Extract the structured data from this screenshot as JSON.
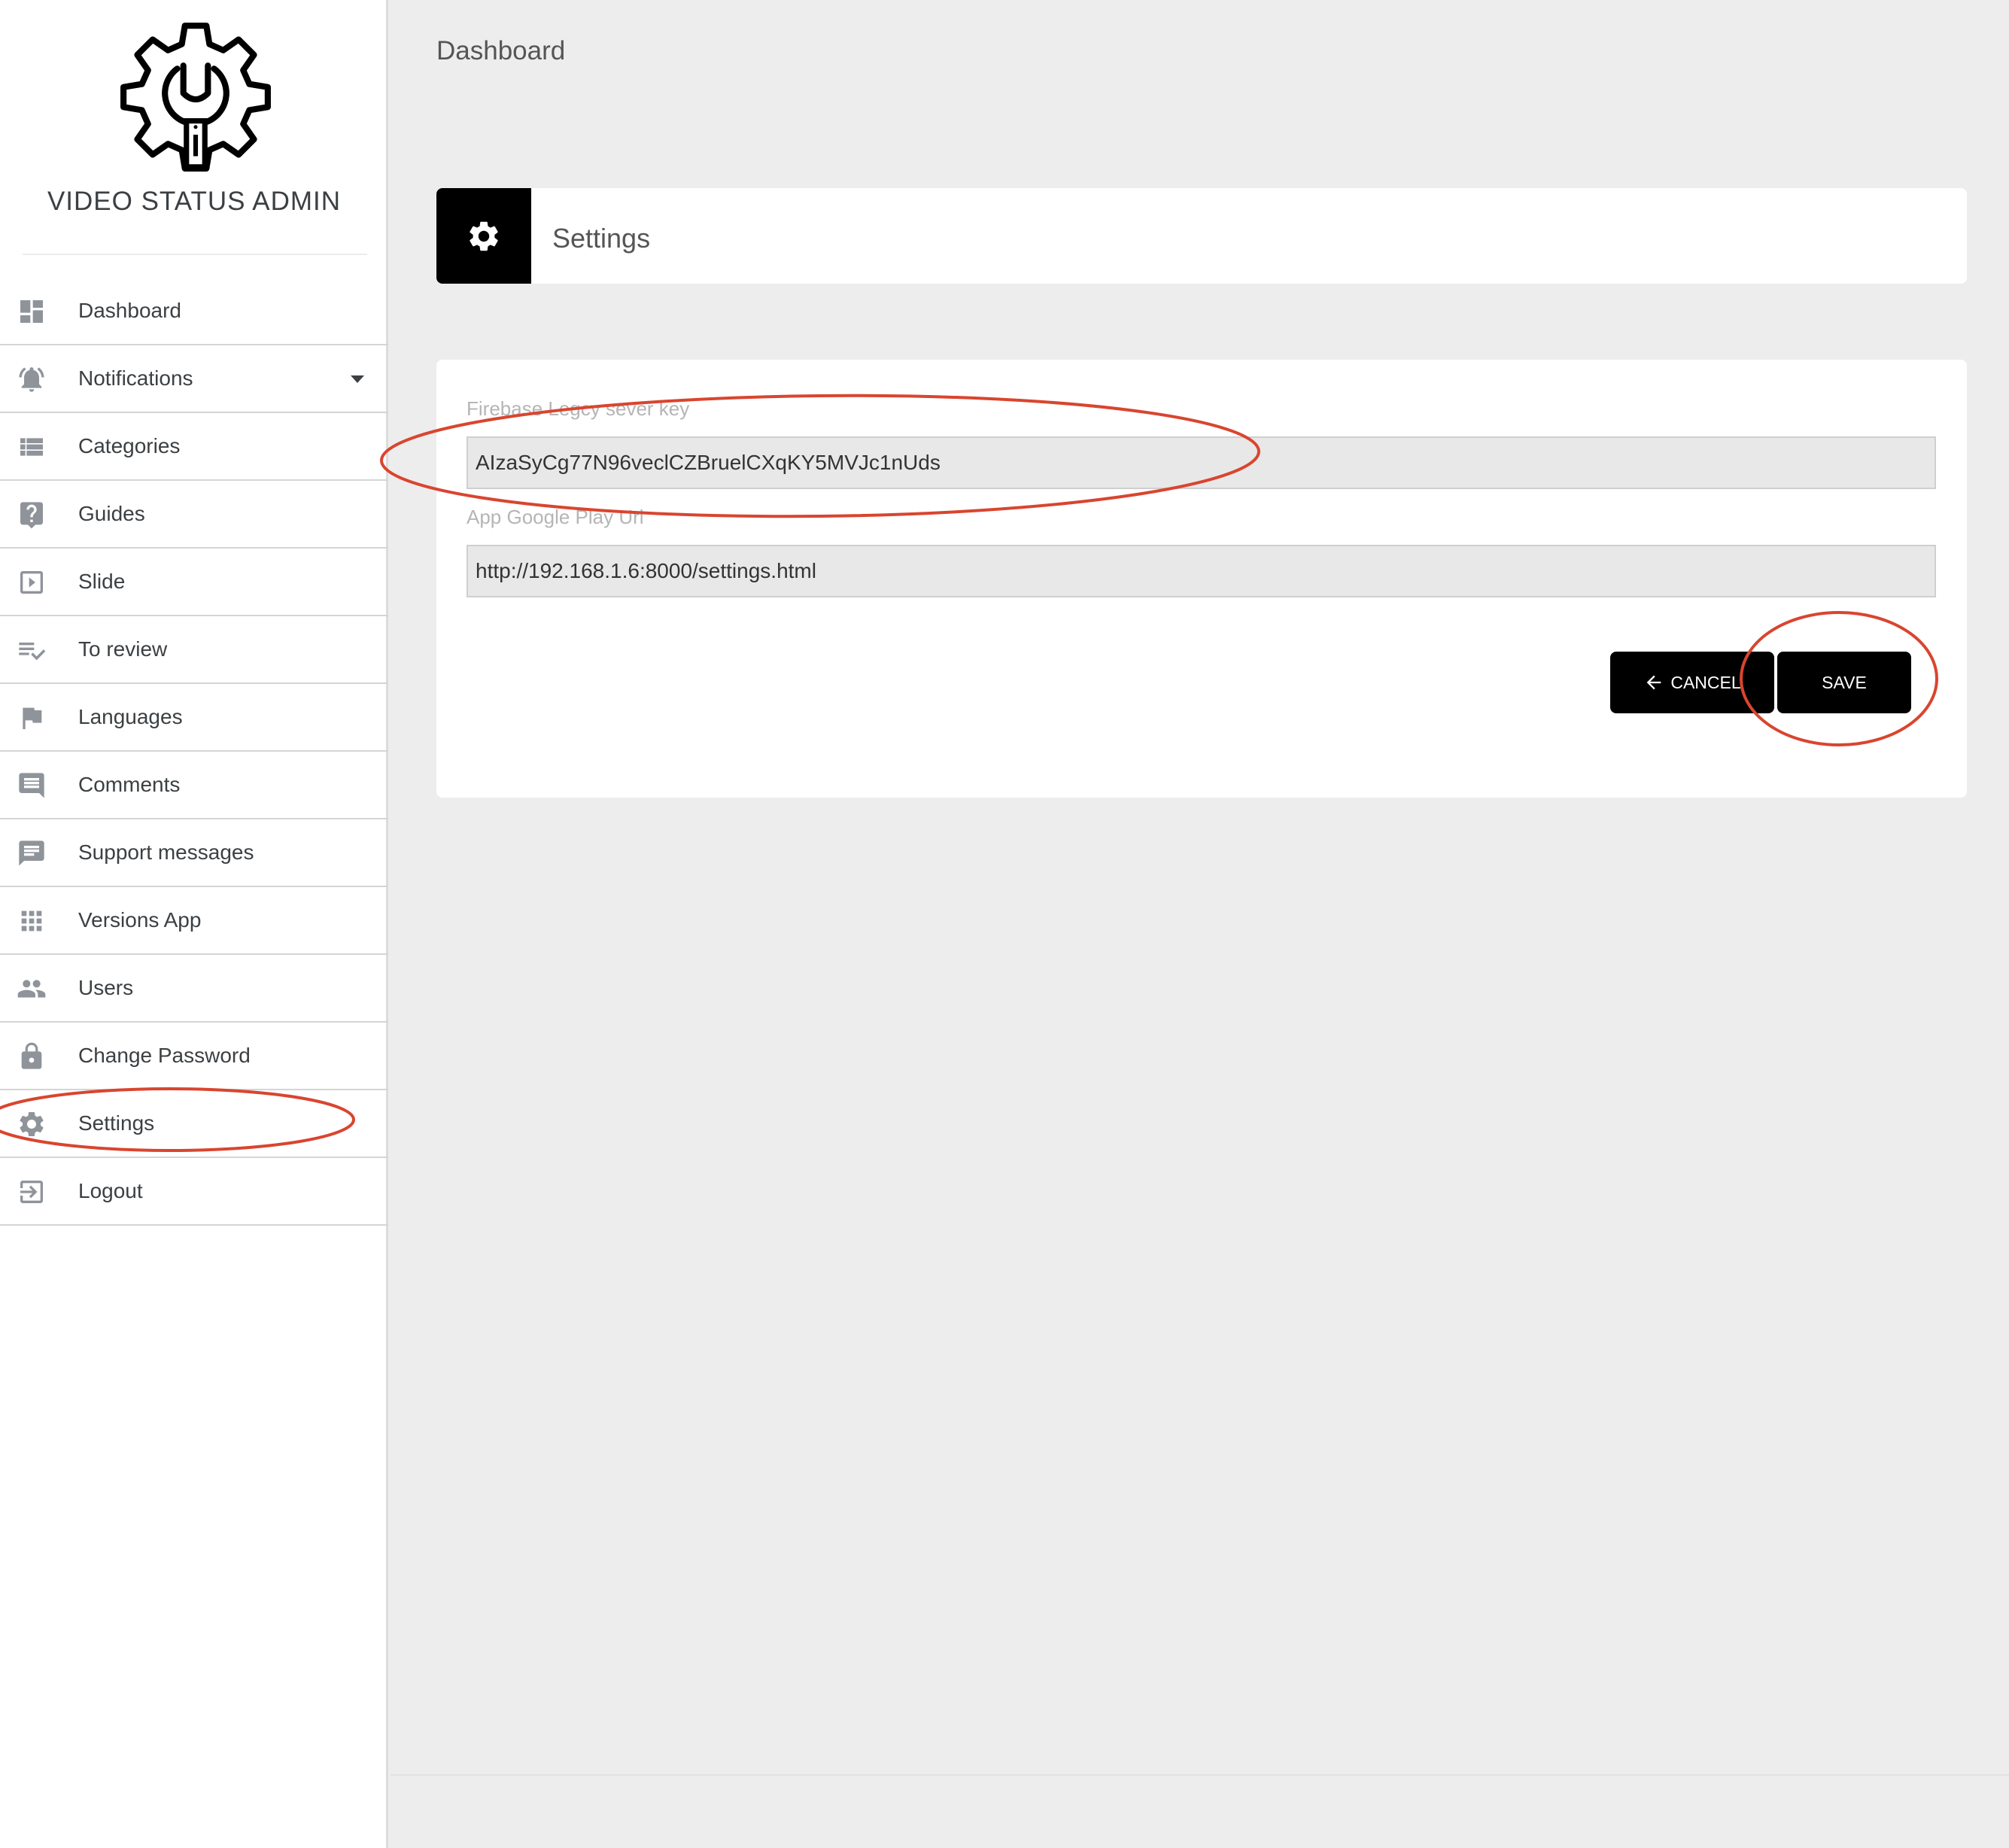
{
  "brand": {
    "name": "VIDEO STATUS ADMIN",
    "logo_icon": "gear-wrench-icon"
  },
  "sidebar": {
    "items": [
      {
        "label": "Dashboard",
        "icon": "dashboard-icon"
      },
      {
        "label": "Notifications",
        "icon": "bell-icon",
        "has_dropdown": true
      },
      {
        "label": "Categories",
        "icon": "list-icon"
      },
      {
        "label": "Guides",
        "icon": "help-icon"
      },
      {
        "label": "Slide",
        "icon": "play-box-icon"
      },
      {
        "label": "To review",
        "icon": "playlist-check-icon"
      },
      {
        "label": "Languages",
        "icon": "flag-icon"
      },
      {
        "label": "Comments",
        "icon": "comment-icon"
      },
      {
        "label": "Support messages",
        "icon": "chat-icon"
      },
      {
        "label": "Versions App",
        "icon": "apps-icon"
      },
      {
        "label": "Users",
        "icon": "people-icon"
      },
      {
        "label": "Change Password",
        "icon": "lock-icon"
      },
      {
        "label": "Settings",
        "icon": "gear-icon"
      },
      {
        "label": "Logout",
        "icon": "logout-icon"
      }
    ]
  },
  "breadcrumb": "Dashboard",
  "settings_header": {
    "title": "Settings",
    "icon": "gear-icon"
  },
  "form": {
    "firebase_key": {
      "label": "Firebase Legcy sever key",
      "value": "AIzaSyCg77N96veclCZBruelCXqKY5MVJc1nUds"
    },
    "play_url": {
      "label": "App Google Play Url",
      "value": "http://192.168.1.6:8000/settings.html"
    },
    "cancel_label": "CANCEL",
    "save_label": "SAVE"
  },
  "colors": {
    "primary": "#000000",
    "background": "#ededed",
    "annotation": "#d9452f"
  }
}
